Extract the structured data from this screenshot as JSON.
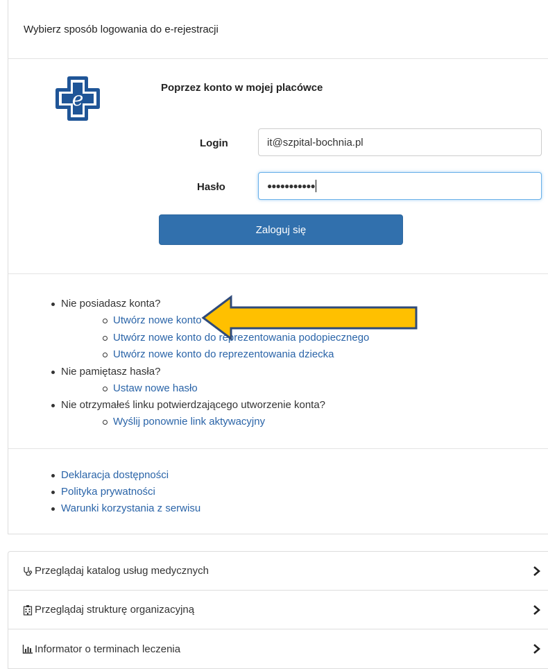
{
  "header": {
    "title": "Wybierz sposób logowania do e-rejestracji"
  },
  "login": {
    "heading": "Poprzez konto w mojej placówce",
    "login_label": "Login",
    "login_value": "it@szpital-bochnia.pl",
    "password_label": "Hasło",
    "password_value": "●●●●●●●●●●●",
    "submit_label": "Zaloguj się"
  },
  "help": {
    "no_account": "Nie posiadasz konta?",
    "create_account": "Utwórz nowe konto",
    "create_ward": "Utwórz nowe konto do reprezentowania podopiecznego",
    "create_child": "Utwórz nowe konto do reprezentowania dziecka",
    "forgot": "Nie pamiętasz hasła?",
    "set_password": "Ustaw nowe hasło",
    "no_link": "Nie otrzymałeś linku potwierdzającego utworzenie konta?",
    "resend": "Wyślij ponownie link aktywacyjny"
  },
  "footer_links": {
    "accessibility": "Deklaracja dostępności",
    "privacy": "Polityka prywatności",
    "terms": "Warunki korzystania z serwisu"
  },
  "nav": {
    "items": [
      {
        "label": "Przeglądaj katalog usług medycznych",
        "icon": "stethoscope-icon"
      },
      {
        "label": "Przeglądaj strukturę organizacyjną",
        "icon": "hospital-icon"
      },
      {
        "label": "Informator o terminach leczenia",
        "icon": "bar-chart-icon"
      }
    ]
  },
  "colors": {
    "primary_button": "#3170ad",
    "link": "#2a64a8",
    "arrow_fill": "#ffc000",
    "arrow_stroke": "#2f4a7a",
    "logo_blue": "#1f5597"
  }
}
